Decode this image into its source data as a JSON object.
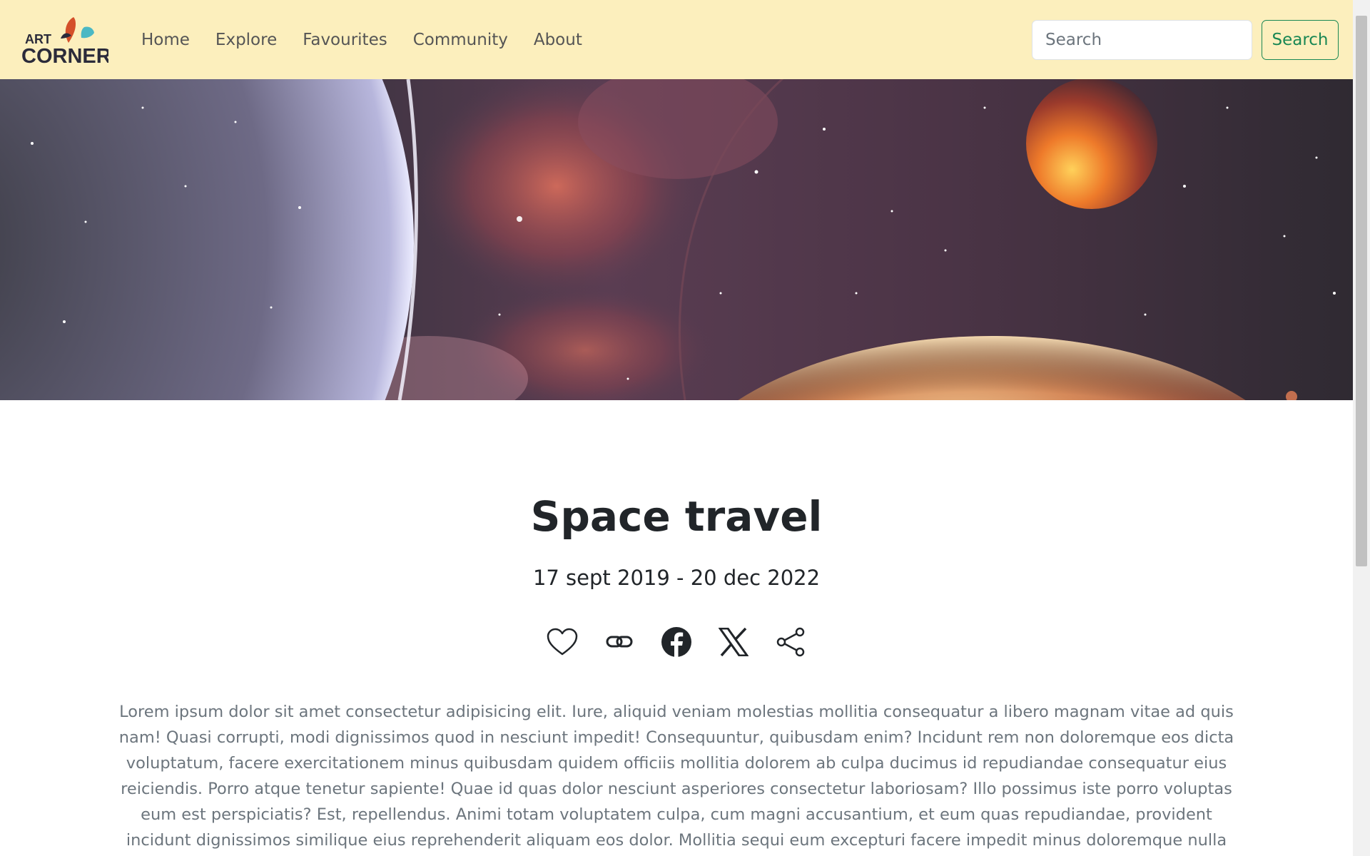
{
  "navbar": {
    "logo": {
      "line1": "ART",
      "line2": "CORNER",
      "icon": "art-corner-logo"
    },
    "links": [
      "Home",
      "Explore",
      "Favourites",
      "Community",
      "About"
    ],
    "search": {
      "placeholder": "Search",
      "value": "",
      "button_label": "Search"
    }
  },
  "hero": {
    "image": "space-planets-illustration"
  },
  "content": {
    "title": "Space travel",
    "dates": "17 sept 2019 - 20 dec 2022",
    "actions": [
      "heart-icon",
      "link-icon",
      "facebook-icon",
      "x-icon",
      "share-icon"
    ],
    "paragraph": "Lorem ipsum dolor sit amet consectetur adipisicing elit. Iure, aliquid veniam molestias mollitia consequatur a libero magnam vitae ad quis nam! Quasi corrupti, modi dignissimos quod in nesciunt impedit! Consequuntur, quibusdam enim? Incidunt rem non doloremque eos dicta voluptatum, facere exercitationem minus quibusdam quidem officiis mollitia dolorem ab culpa ducimus id repudiandae consequatur eius reiciendis. Porro atque tenetur sapiente! Quae id quas dolor nesciunt asperiores consectetur laboriosam? Illo possimus iste porro voluptas eum est perspiciatis? Est, repellendus. Animi totam voluptatem culpa, cum magni accusantium, et eum quas repudiandae, provident incidunt dignissimos similique eius reprehenderit aliquam eos dolor. Mollitia sequi eum excepturi facere impedit minus doloremque nulla voluptatum est earum. Mollitia, atque ipsum culpa illo"
  },
  "colors": {
    "navbar_bg": "#fcefbd",
    "search_button": "#198754",
    "logo_orange": "#d4502a",
    "logo_teal": "#4bb8c4",
    "logo_text": "#2b2b3a"
  }
}
